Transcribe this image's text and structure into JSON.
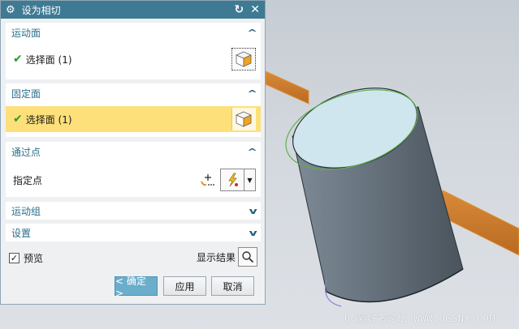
{
  "dialog": {
    "title": "设为相切",
    "reset_icon": "↻",
    "close_icon": "✕"
  },
  "sections": {
    "motion_face": {
      "header": "运动面",
      "item_label": "选择面 (1)",
      "collapse_icon": "chevron-up"
    },
    "fixed_face": {
      "header": "固定面",
      "item_label": "选择面 (1)",
      "collapse_icon": "chevron-up"
    },
    "through_point": {
      "header": "通过点",
      "item_label": "指定点",
      "collapse_icon": "chevron-up"
    },
    "motion_group": {
      "header": "运动组",
      "collapse_icon": "chevron-down"
    },
    "settings": {
      "header": "设置",
      "collapse_icon": "chevron-down"
    }
  },
  "footer": {
    "preview_label": "预览",
    "preview_checked": true,
    "show_result_label": "显示结果",
    "ok_label": "< 确定 >",
    "apply_label": "应用",
    "cancel_label": "取消"
  },
  "viewport": {
    "watermark": "UG爱好者论坛 WWW.UGSNX.COM"
  },
  "colors": {
    "title_bar": "#3f7a94",
    "section_header_text": "#2a6f8a",
    "highlight_row": "#fde07a",
    "primary_button": "#6aaecc",
    "bar_orange": "#c97a2b"
  }
}
